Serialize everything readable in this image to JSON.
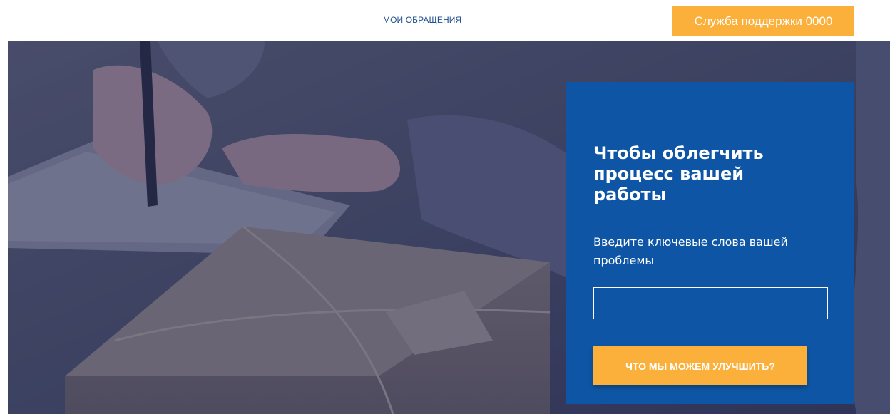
{
  "header": {
    "nav_link": "МОИ ОБРАЩЕНИЯ",
    "support_button": "Служба поддержки 0000"
  },
  "hero": {
    "image_description_icon": "photo-hands-writing-parcel"
  },
  "panel": {
    "title": "Чтобы облегчить процесс вашей работы",
    "subtitle": "Введите ключевые слова вашей проблемы",
    "input_value": "",
    "button_label": "ЧТО МЫ МОЖЕМ УЛУЧШИТЬ?"
  },
  "colors": {
    "accent": "#fbb03b",
    "panel_blue": "#0e56a5",
    "nav_text": "#1f4f8f"
  }
}
